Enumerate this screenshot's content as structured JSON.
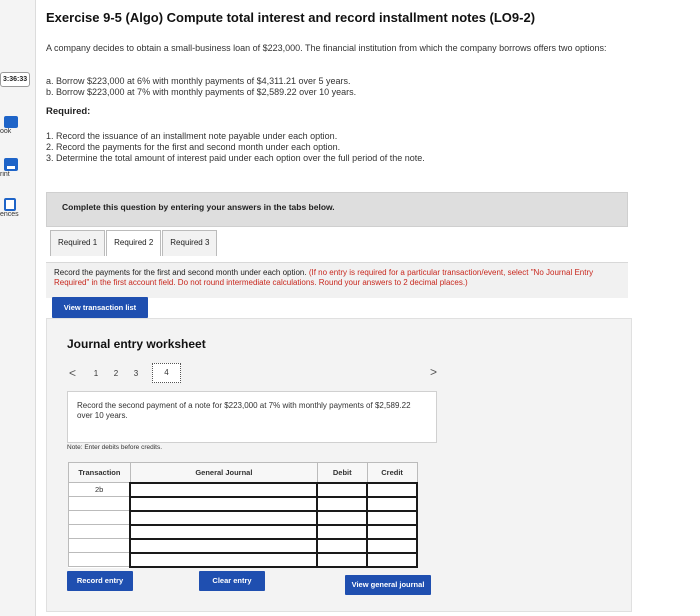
{
  "sidebar": {
    "timer": "3:36:33",
    "tools": [
      {
        "label": "ook",
        "icon": "book-icon"
      },
      {
        "label": "rint",
        "icon": "print-icon"
      },
      {
        "label": "ences",
        "icon": "references-icon"
      }
    ]
  },
  "exercise": {
    "title": "Exercise 9-5 (Algo) Compute total interest and record installment notes (LO9-2)",
    "intro": "A company decides to obtain a small-business loan of $223,000. The financial institution from which the company borrows offers two options:",
    "option_a": "a. Borrow $223,000 at 6% with monthly payments of $4,311.21 over 5 years.",
    "option_b": "b. Borrow $223,000 at 7% with monthly payments of $2,589.22 over 10 years.",
    "required_label": "Required:",
    "requirements": [
      "1. Record the issuance of an installment note payable under each option.",
      "2. Record the payments for the first and second month under each option.",
      "3. Determine the total amount of interest paid under each option over the full period of the note."
    ]
  },
  "complete_bar": "Complete this question by entering your answers in the tabs below.",
  "tabs": [
    "Required 1",
    "Required 2",
    "Required 3"
  ],
  "instructions": {
    "main": "Record the payments for the first and second month under each option.",
    "red": " (If no entry is required for a particular transaction/event, select \"No Journal Entry Required\" in the first account field. Do not round intermediate calculations. Round your answers to 2 decimal places.)"
  },
  "view_transaction_button": "View transaction list",
  "worksheet": {
    "title": "Journal entry worksheet",
    "prev_arrow": "<",
    "next_arrow": ">",
    "pages": [
      "1",
      "2",
      "3",
      "4"
    ],
    "current_page": "4",
    "description": "Record the second payment of a note for $223,000 at 7% with monthly payments of $2,589.22 over 10 years.",
    "note": "Note: Enter debits before credits.",
    "columns": [
      "Transaction",
      "General Journal",
      "Debit",
      "Credit"
    ],
    "rows": [
      "2b",
      "",
      "",
      "",
      "",
      ""
    ],
    "buttons": {
      "record": "Record entry",
      "clear": "Clear entry",
      "view_journal": "View general journal"
    }
  }
}
